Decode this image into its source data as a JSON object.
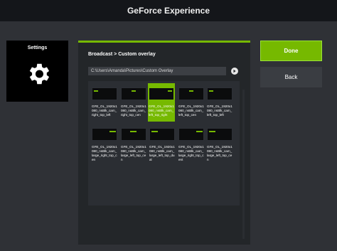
{
  "window": {
    "title": "GeForce Experience"
  },
  "sidebar": {
    "settings_label": "Settings",
    "icon": "gear-icon"
  },
  "panel": {
    "heading": "Broadcast > Custom overlay",
    "path": "C:\\Users\\Amanda\\Pictures\\Custom Overlay",
    "go_icon": "arrow-right-circle-icon"
  },
  "thumbnails": [
    {
      "caption": "GFE_OL_1920x1080_nsBlk_cam_right_top_left"
    },
    {
      "caption": "GFE_OL_1920x1080_nsBlk_cam_right_top_cen"
    },
    {
      "caption": "GFE_OL_1920x1080_nsBlk_cam_left_top_right",
      "selected": true
    },
    {
      "caption": "GFE_OL_1920x1080_nsBlk_cam_left_top_cen"
    },
    {
      "caption": "GFE_OL_1920x1080_nsBlk_cam_left_top_left"
    },
    {
      "caption": "GFE_OL_1920x1080_nsBlk_cam_large_right_top_cen"
    },
    {
      "caption": "GFE_OL_1920x1080_nsBlk_cam_large_left_top_cen"
    },
    {
      "caption": "GFE_OL_1920x1080_nsBlk_cam_large_left_top_dual"
    },
    {
      "caption": "GFE_OL_1920x1080_nsBlk_cam_large_right_top_cent"
    },
    {
      "caption": "GFE_OL_1920x1080_nsBlk_cam_large_left_top_cen"
    }
  ],
  "actions": {
    "done": "Done",
    "back": "Back"
  },
  "colors": {
    "accent": "#76b900",
    "background": "#2f3136",
    "panel": "#232629"
  }
}
